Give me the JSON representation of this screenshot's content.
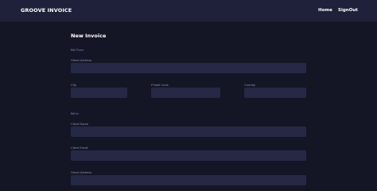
{
  "header": {
    "brand": "GROOVE INVOICE",
    "nav": {
      "home": "Home",
      "signout": "SignOut"
    }
  },
  "form": {
    "title": "New Invoice",
    "bill_from": {
      "section_label": "Bill From",
      "street_address_label": "Street Address",
      "street_address_value": "",
      "city_label": "City",
      "city_value": "",
      "postal_code_label": "Postal Code",
      "postal_code_value": "",
      "country_label": "Country",
      "country_value": ""
    },
    "bill_to": {
      "section_label": "Bill to",
      "client_name_label": "Client Name",
      "client_name_value": "",
      "client_email_label": "Client Email",
      "client_email_value": "",
      "street_address_label": "Street Address",
      "street_address_value": ""
    }
  },
  "colors": {
    "background": "#141625",
    "header_bg": "#1e2139",
    "input_bg": "#252945",
    "label": "#888eb0"
  }
}
